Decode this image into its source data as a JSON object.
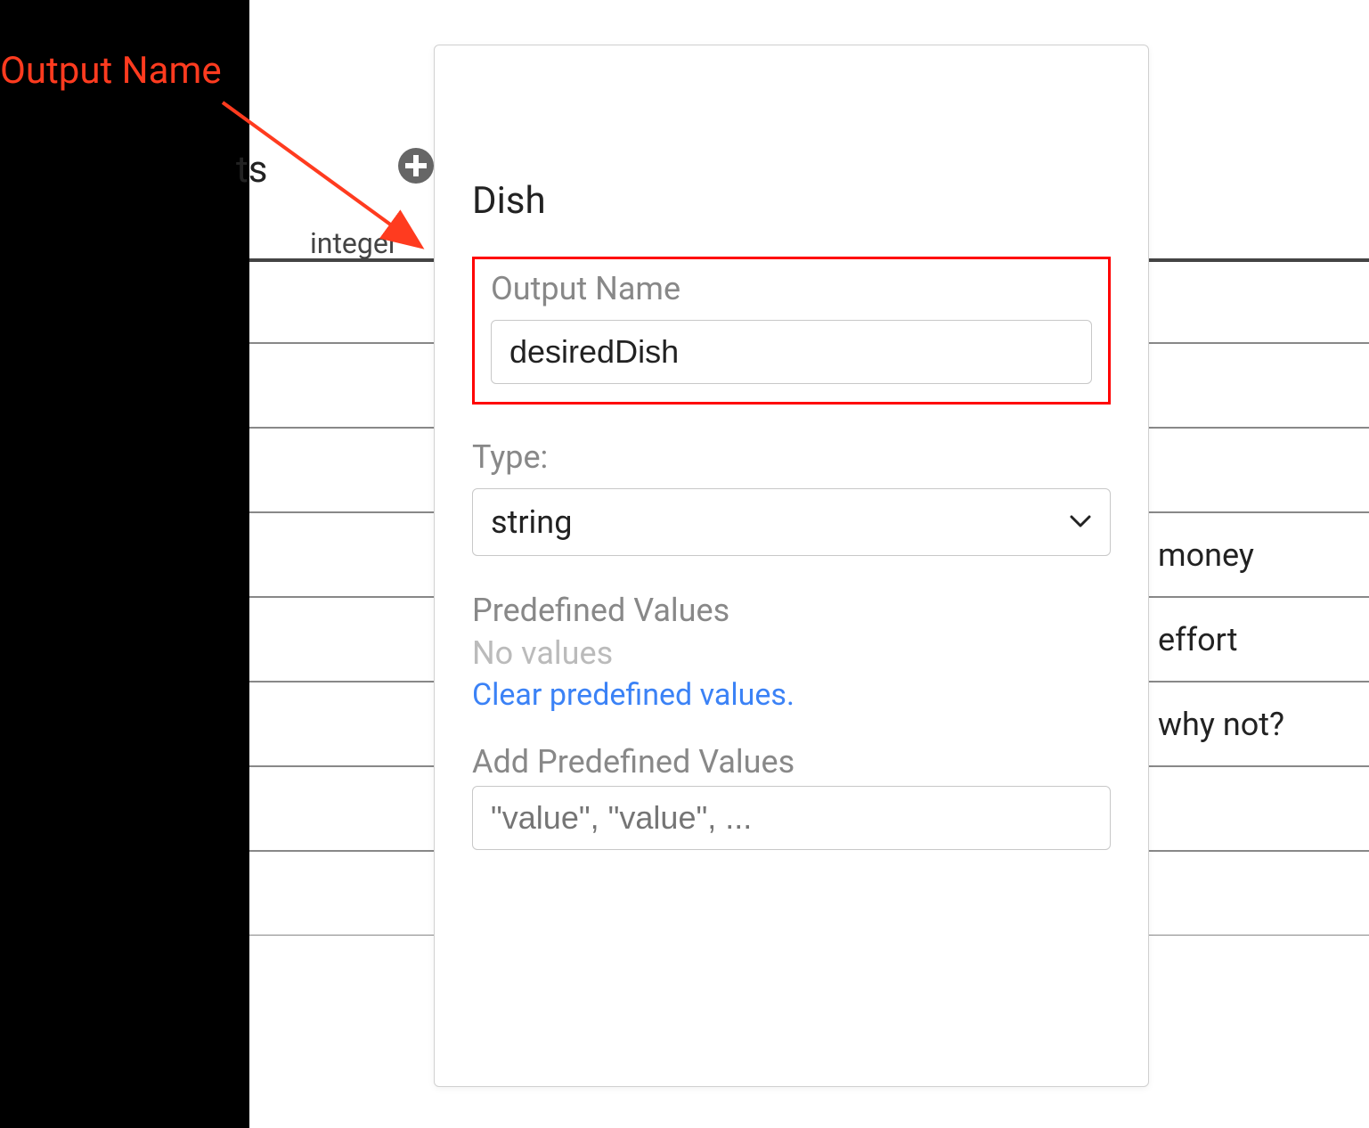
{
  "annotation": {
    "label": "Output Name"
  },
  "background": {
    "partial_text": "ts",
    "integer_label": "integer",
    "rows": [
      "",
      "",
      "",
      "money",
      "effort",
      "why not?",
      "",
      ""
    ]
  },
  "panel": {
    "title": "Dish",
    "output_name_label": "Output Name",
    "output_name_value": "desiredDish",
    "type_label": "Type:",
    "type_value": "string",
    "predefined_values_label": "Predefined Values",
    "no_values_text": "No values",
    "clear_link": "Clear predefined values.",
    "add_predefined_label": "Add Predefined Values",
    "add_predefined_placeholder": "\"value\", \"value\", ..."
  }
}
